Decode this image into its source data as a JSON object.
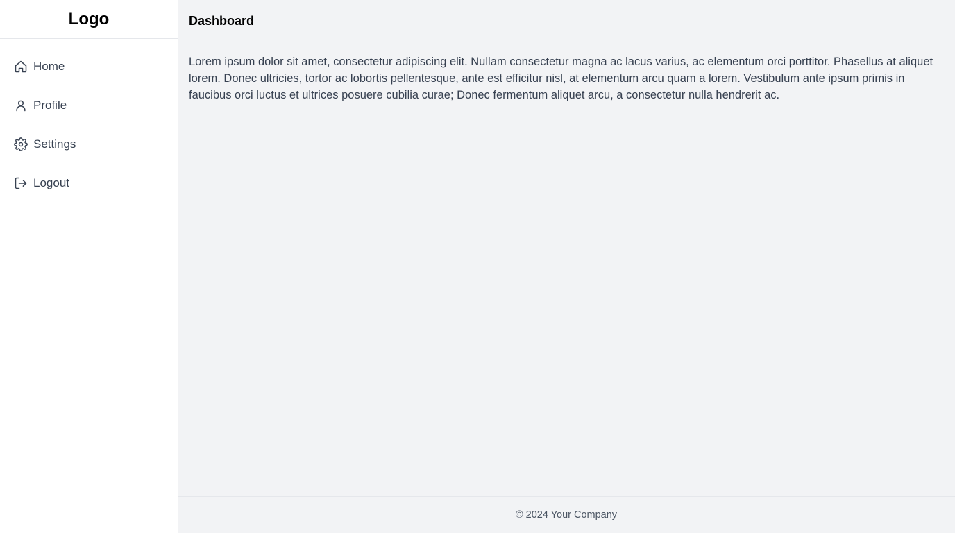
{
  "sidebar": {
    "logo": "Logo",
    "items": [
      {
        "label": "Home",
        "icon": "home-icon"
      },
      {
        "label": "Profile",
        "icon": "user-icon"
      },
      {
        "label": "Settings",
        "icon": "gear-icon"
      },
      {
        "label": "Logout",
        "icon": "logout-icon"
      }
    ]
  },
  "header": {
    "title": "Dashboard"
  },
  "main": {
    "body": "Lorem ipsum dolor sit amet, consectetur adipiscing elit. Nullam consectetur magna ac lacus varius, ac elementum orci porttitor. Phasellus at aliquet lorem. Donec ultricies, tortor ac lobortis pellentesque, ante est efficitur nisl, at elementum arcu quam a lorem. Vestibulum ante ipsum primis in faucibus orci luctus et ultrices posuere cubilia curae; Donec fermentum aliquet arcu, a consectetur nulla hendrerit ac."
  },
  "footer": {
    "copyright": "© 2024 Your Company"
  },
  "colors": {
    "sidebar_bg": "#ffffff",
    "main_bg": "#f2f3f5",
    "border": "#e5e7eb",
    "text": "#374151"
  }
}
